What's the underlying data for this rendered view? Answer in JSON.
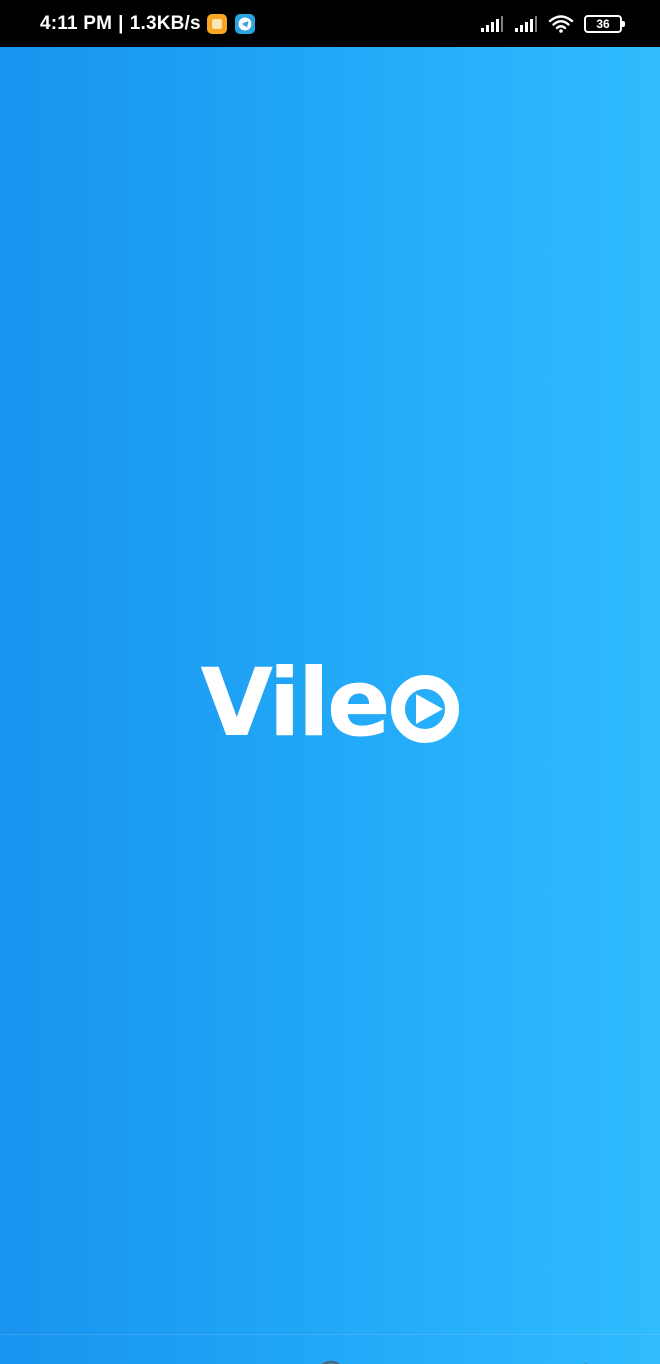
{
  "status_bar": {
    "time": "4:11 PM",
    "separator": "|",
    "network_speed": "1.3KB/s",
    "battery_level": "36",
    "icons": [
      "notification-app-icon",
      "telegram-icon",
      "signal-icon",
      "signal-icon",
      "wifi-icon",
      "battery-icon"
    ]
  },
  "splash": {
    "logo_text": "Vile",
    "logo_icon": "play-icon",
    "gradient_start": "#1893ef",
    "gradient_end": "#30bcff"
  },
  "nav_bar": {
    "buttons": [
      "back-icon",
      "home-icon",
      "recents-icon",
      "accessibility-icon"
    ]
  }
}
